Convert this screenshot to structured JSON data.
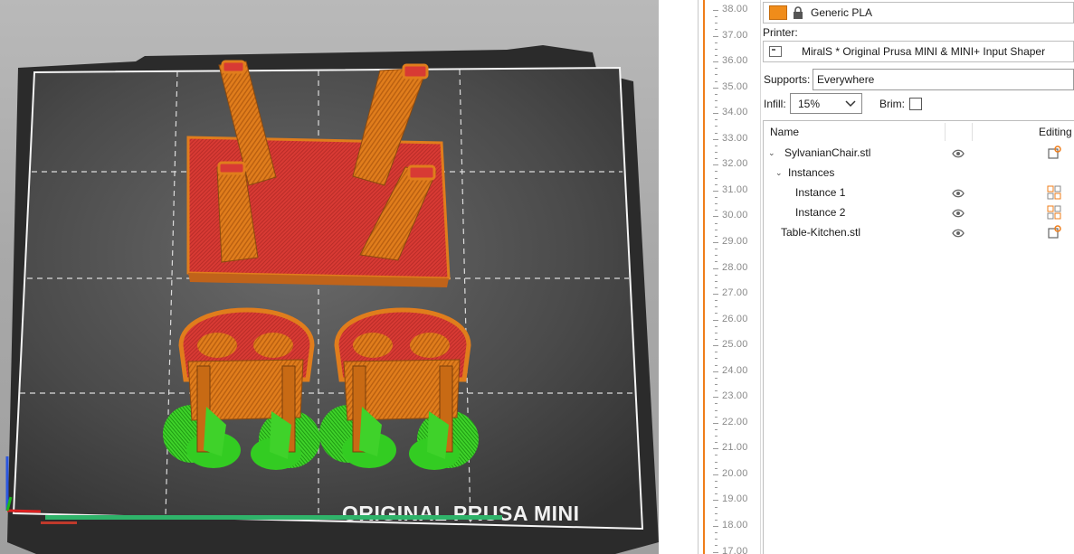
{
  "viewport": {
    "bed_label": "ORIGINAL PRUSA MINI",
    "colors": {
      "bed": "#3a3a3a",
      "model_orange": "#e07d1c",
      "model_red": "#d83a34",
      "support_green": "#33cc22"
    }
  },
  "layer_slider": {
    "ticks": [
      "38.00",
      "37.00",
      "36.00",
      "35.00",
      "34.00",
      "33.00",
      "32.00",
      "31.00",
      "30.00",
      "29.00",
      "28.00",
      "27.00",
      "26.00",
      "25.00",
      "24.00",
      "23.00",
      "22.00",
      "21.00",
      "20.00",
      "19.00",
      "18.00",
      "17.00"
    ]
  },
  "panel": {
    "filament": {
      "value": "Generic PLA",
      "swatch_color": "#f08c1a"
    },
    "printer": {
      "label": "Printer:",
      "value": "MiralS * Original Prusa MINI & MINI+ Input Shaper"
    },
    "supports": {
      "label": "Supports:",
      "value": "Everywhere"
    },
    "infill": {
      "label": "Infill:",
      "value": "15%"
    },
    "brim": {
      "label": "Brim:"
    },
    "objects": {
      "col_name": "Name",
      "col_editing": "Editing",
      "rows": [
        {
          "label": "SylvanianChair.stl"
        },
        {
          "label": "Instances"
        },
        {
          "label": "Instance 1"
        },
        {
          "label": "Instance 2"
        },
        {
          "label": "Table-Kitchen.stl"
        }
      ]
    }
  }
}
